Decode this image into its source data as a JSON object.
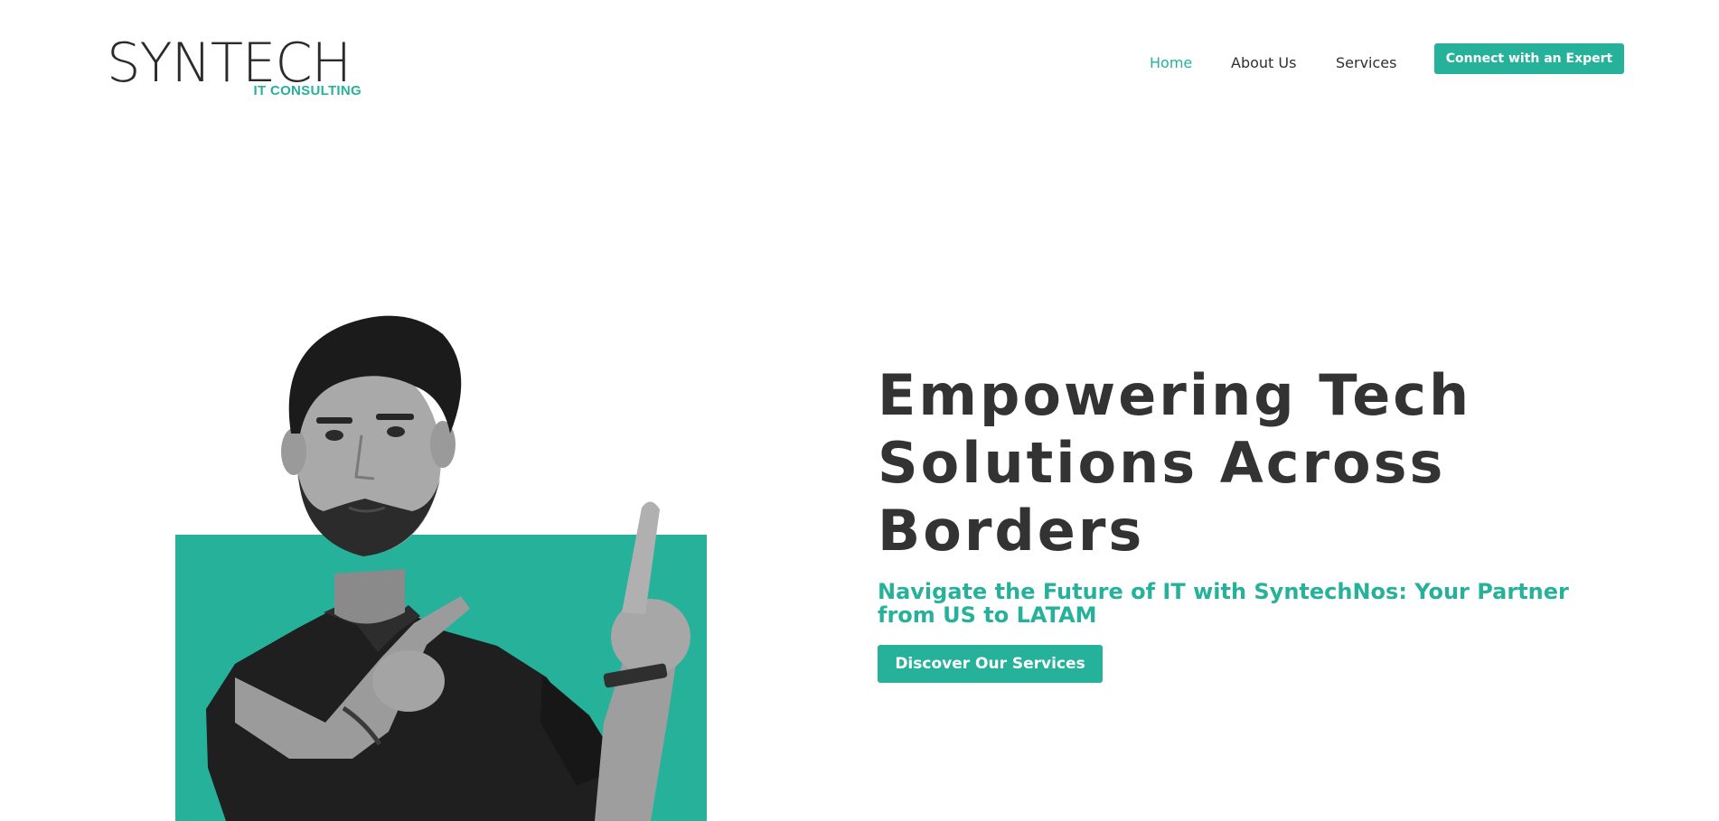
{
  "brand": {
    "name": "SYNTECH",
    "tagline": "IT CONSULTING"
  },
  "nav": {
    "items": [
      {
        "label": "Home",
        "active": true
      },
      {
        "label": "About Us",
        "active": false
      },
      {
        "label": "Services",
        "active": false
      }
    ],
    "cta_label": "Connect with an Expert"
  },
  "hero": {
    "title": "Empowering Tech Solutions Across Borders",
    "subtitle": "Navigate the Future of IT with SyntechNos: Your Partner from US to LATAM",
    "cta_label": "Discover Our Services",
    "image_icon": "person-pointing-photo"
  },
  "colors": {
    "accent": "#26b19b",
    "text_dark": "#333333",
    "background": "#ffffff"
  }
}
